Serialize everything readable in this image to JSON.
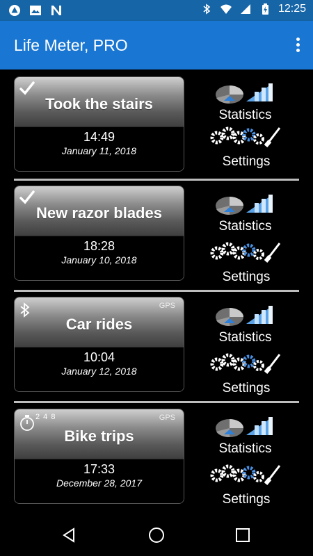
{
  "status_bar": {
    "time": "12:25",
    "icons": [
      "alert-triangle-icon",
      "image-icon",
      "n-logo-icon",
      "bluetooth-icon",
      "wifi-icon",
      "signal-icon",
      "battery-charging-icon"
    ]
  },
  "app_bar": {
    "title": "Life Meter, PRO",
    "menu_icon": "overflow-menu-icon"
  },
  "meters": [
    {
      "title": "Took the stairs",
      "time": "14:49",
      "date": "January 11, 2018",
      "badge": "check",
      "gps": ""
    },
    {
      "title": "New razor blades",
      "time": "18:28",
      "date": "January 10, 2018",
      "badge": "check",
      "gps": ""
    },
    {
      "title": "Car rides",
      "time": "10:04",
      "date": "January 12, 2018",
      "badge": "bluetooth",
      "gps": "GPS"
    },
    {
      "title": "Bike trips",
      "time": "17:33",
      "date": "December 28, 2017",
      "badge": "timer",
      "timer_nums": "2 4 8",
      "gps": "GPS"
    }
  ],
  "actions": {
    "statistics_label": "Statistics",
    "settings_label": "Settings"
  },
  "colors": {
    "status_bar": "#1565a7",
    "app_bar": "#1976d2",
    "background": "#000000",
    "divider": "#bdbdbd"
  },
  "nav_bar": {
    "buttons": [
      "back-icon",
      "home-icon",
      "recent-apps-icon"
    ]
  }
}
